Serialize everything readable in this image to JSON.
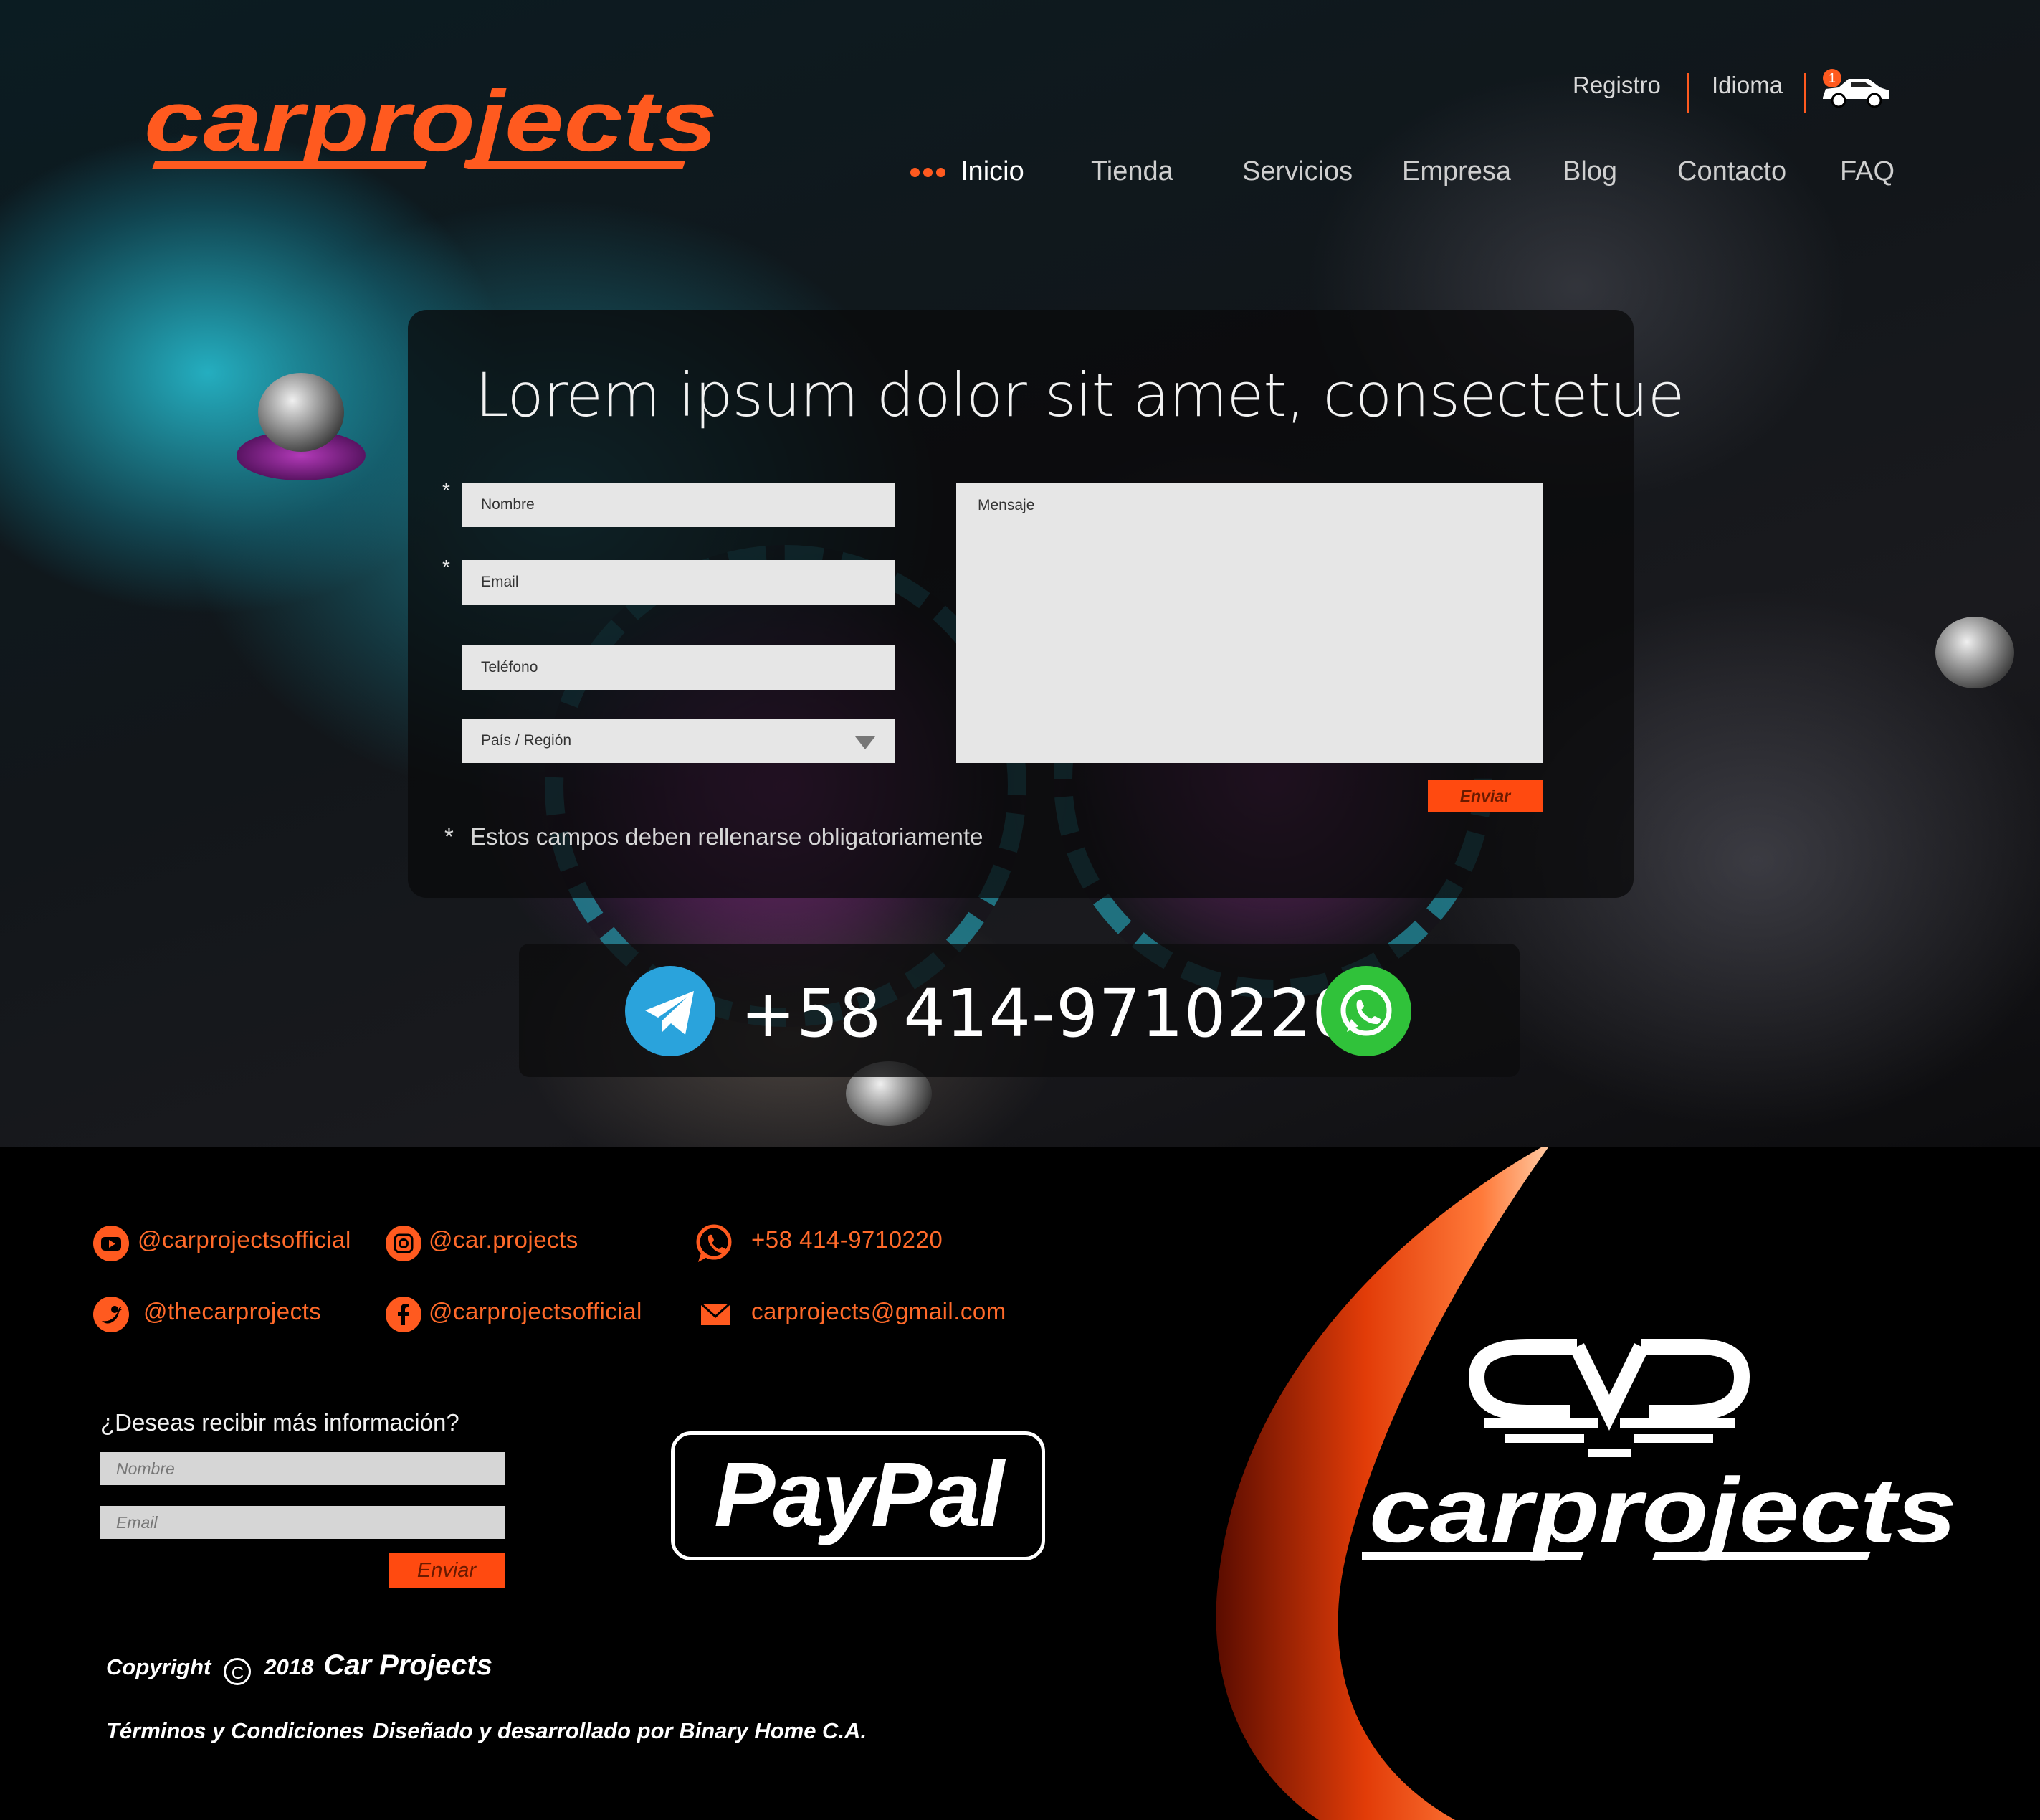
{
  "brand": {
    "logo_text": "carprojects",
    "accent": "#ff5a1f"
  },
  "topnav": {
    "registro": "Registro",
    "idioma": "Idioma",
    "cart_count": "1"
  },
  "mainnav": {
    "items": [
      "Inicio",
      "Tienda",
      "Servicios",
      "Empresa",
      "Blog",
      "Contacto",
      "FAQ"
    ],
    "active": "Inicio"
  },
  "form": {
    "title": "Lorem ipsum dolor sit amet, consectetue",
    "name_placeholder": "Nombre",
    "email_placeholder": "Email",
    "phone_placeholder": "Teléfono",
    "country_placeholder": "País / Región",
    "message_placeholder": "Mensaje",
    "submit_label": "Enviar",
    "required_mark": "*",
    "required_note": "Estos campos deben rellenarse obligatoriamente"
  },
  "contact_bar": {
    "phone": "+58 414-9710220",
    "icons": [
      "telegram-icon",
      "whatsapp-icon"
    ]
  },
  "footer": {
    "social": {
      "youtube": "@carprojectsofficial",
      "instagram": "@car.projects",
      "twitter": "@thecarprojects",
      "facebook": "@carprojectsofficial",
      "whatsapp": "+58 414-9710220",
      "email": "carprojects@gmail.com"
    },
    "newsletter": {
      "label": "¿Deseas recibir más información?",
      "name_placeholder": "Nombre",
      "email_placeholder": "Email",
      "submit_label": "Enviar"
    },
    "paypal": "PayPal",
    "logo_text": "carprojects",
    "copyright": {
      "word": "Copyright",
      "symbol": "C",
      "year": "2018",
      "company": "Car Projects"
    },
    "terms": "Términos y Condiciones",
    "credits": "Diseñado y desarrollado por Binary Home C.A."
  }
}
